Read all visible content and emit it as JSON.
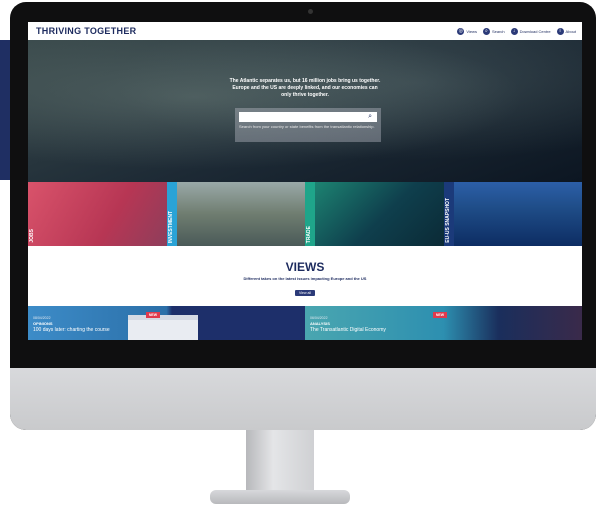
{
  "site": {
    "logo": "THRIVING TOGETHER"
  },
  "nav": [
    {
      "label": "Views",
      "icon": "views-icon"
    },
    {
      "label": "Search",
      "icon": "search-icon"
    },
    {
      "label": "Download Centre",
      "icon": "download-icon"
    },
    {
      "label": "About",
      "icon": "about-icon"
    }
  ],
  "hero": {
    "text": "The Atlantic separates us, but 16 million jobs bring us together. Europe and the US are deeply linked, and our economies can only thrive together.",
    "search_placeholder": "",
    "search_hint": "Search from your country or state benefits from the transatlantic relationship."
  },
  "tiles": [
    {
      "label": "JOBS"
    },
    {
      "label": "INVESTMENT"
    },
    {
      "label": "TRADE"
    },
    {
      "label": "EU-US SNAPSHOT"
    }
  ],
  "views": {
    "title": "VIEWS",
    "subtitle": "Different takes on the latest issues impacting Europe and the US",
    "button": "View all"
  },
  "cards": [
    {
      "date": "08/04/2022",
      "category": "OPINIONS",
      "title": "100 days later: charting the course",
      "badge": "NEW"
    },
    {
      "date": "06/04/2022",
      "category": "ANALYSIS",
      "title": "The Transatlantic Digital Economy",
      "badge": "NEW"
    }
  ],
  "colors": {
    "navy": "#1c2a5e",
    "accent_red": "#e03a4e"
  }
}
